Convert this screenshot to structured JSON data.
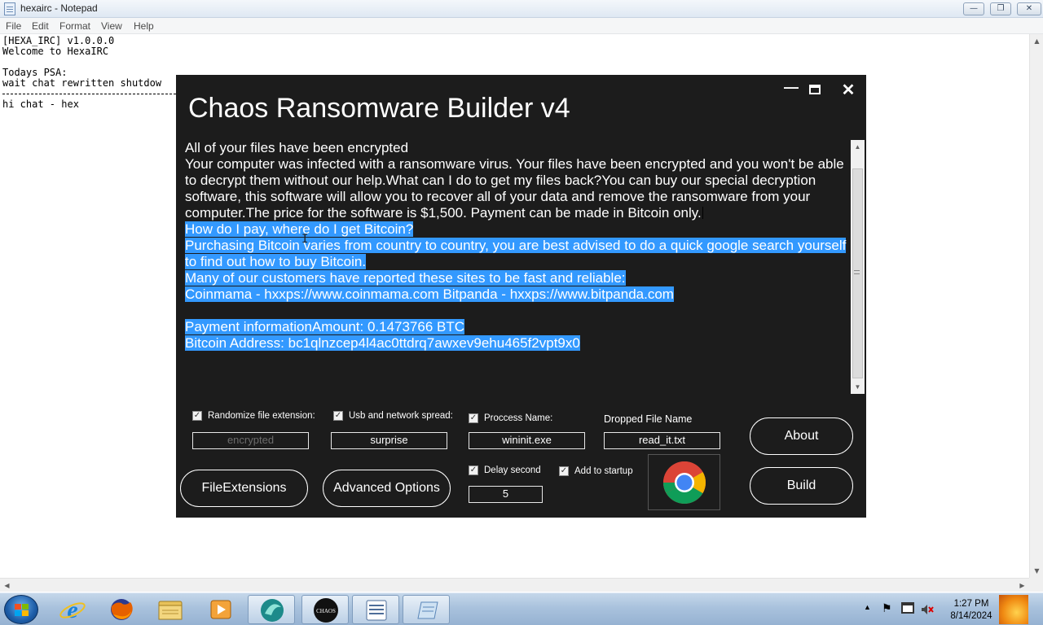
{
  "notepad": {
    "title": "hexairc - Notepad",
    "menu": [
      "File",
      "Edit",
      "Format",
      "View",
      "Help"
    ],
    "lines": [
      "[HEXA_IRC] v1.0.0.0",
      "Welcome to HexaIRC",
      "",
      "Todays PSA:",
      "wait chat rewritten shutdow",
      "",
      "hi chat - hex"
    ]
  },
  "chaos": {
    "title": "Chaos Ransomware Builder v4",
    "note": {
      "heading": "All of your files have been encrypted",
      "body": "Your computer was infected with a ransomware virus. Your files have been encrypted and you won't be able to decrypt them without our help.What can I do to get my files back?You can buy our special decryption software, this software will allow you to recover all of your data and remove the ransomware from your computer.The price for the software is $1,500. Payment can be made in Bitcoin only.",
      "selected": [
        "How do I pay, where do I get Bitcoin?",
        "Purchasing Bitcoin varies from country to country, you are best advised to do a quick google search yourself  to find out how to buy Bitcoin. ",
        "Many of our customers have reported these sites to be fast and reliable:",
        "Coinmama - hxxps://www.coinmama.com Bitpanda - hxxps://www.bitpanda.com",
        "",
        "Payment informationAmount: 0.1473766 BTC",
        "Bitcoin Address:  bc1qlnzcep4l4ac0ttdrq7awxev9ehu465f2vpt9x0"
      ]
    },
    "options": {
      "randomize_label": "Randomize file extension:",
      "randomize_value": "encrypted",
      "usb_label": "Usb and network spread:",
      "usb_value": "surprise",
      "process_label": "Proccess Name:",
      "process_value": "wininit.exe",
      "dropped_label": "Dropped File Name",
      "dropped_value": "read_it.txt",
      "delay_label": "Delay second",
      "delay_value": "5",
      "startup_label": "Add to startup",
      "checkmark": "✓"
    },
    "buttons": {
      "file_extensions": "FileExtensions",
      "advanced_options": "Advanced Options",
      "about": "About",
      "build": "Build"
    }
  },
  "taskbar": {
    "time": "1:27 PM",
    "date": "8/14/2024",
    "chaos_label": "CHAOS"
  },
  "icons": {
    "min": "—",
    "max": "❐",
    "close": "✕",
    "up": "▲",
    "down": "▼",
    "left": "◀",
    "right": "▶",
    "ibeam": "I",
    "tray_up": "▲",
    "tray_flag": "⚑"
  }
}
